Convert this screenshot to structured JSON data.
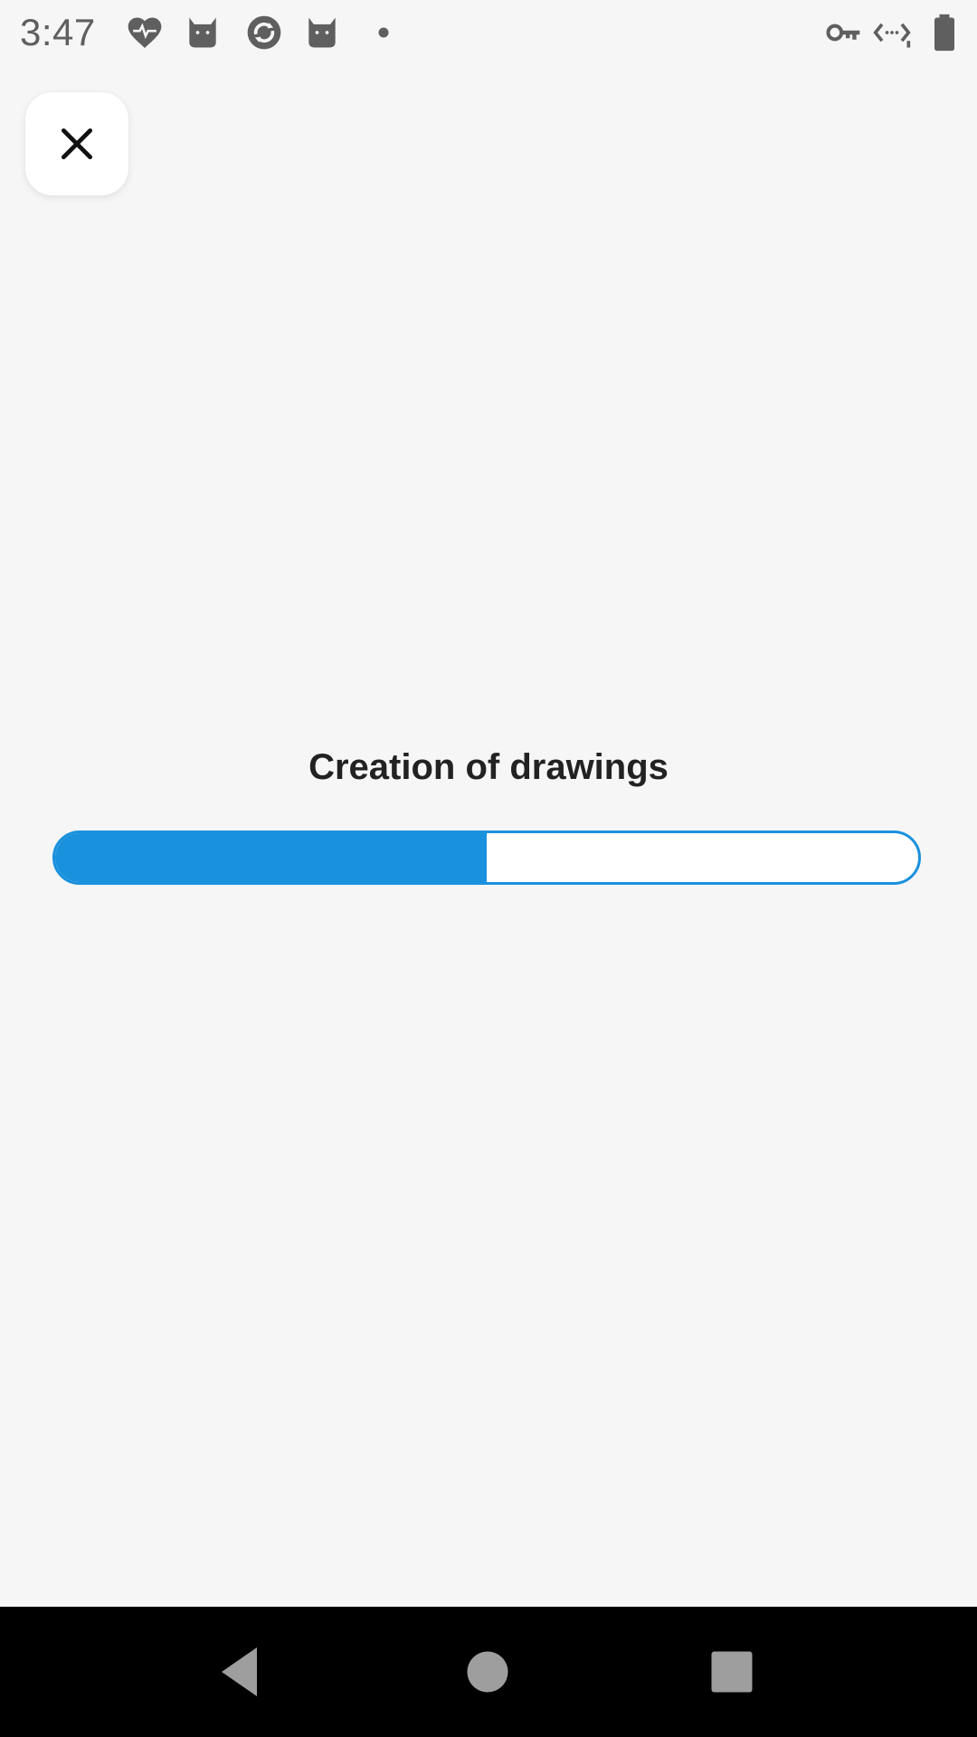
{
  "status_bar": {
    "time": "3:47",
    "left_icons": [
      "heart-pulse-icon",
      "cat-icon",
      "sync-icon",
      "cat-icon",
      "dot-icon"
    ],
    "right_icons": [
      "vpn-key-icon",
      "data-saver-icon",
      "battery-icon"
    ],
    "icon_color": "#5f5f5f"
  },
  "top_bar": {
    "close_icon": "close-icon"
  },
  "progress": {
    "title": "Creation of drawings",
    "value_fraction": 0.5,
    "color": "#1a91dd"
  },
  "nav_bar": {
    "buttons": [
      "back-icon",
      "home-icon",
      "recents-icon"
    ],
    "icon_color": "#9e9e9e"
  }
}
